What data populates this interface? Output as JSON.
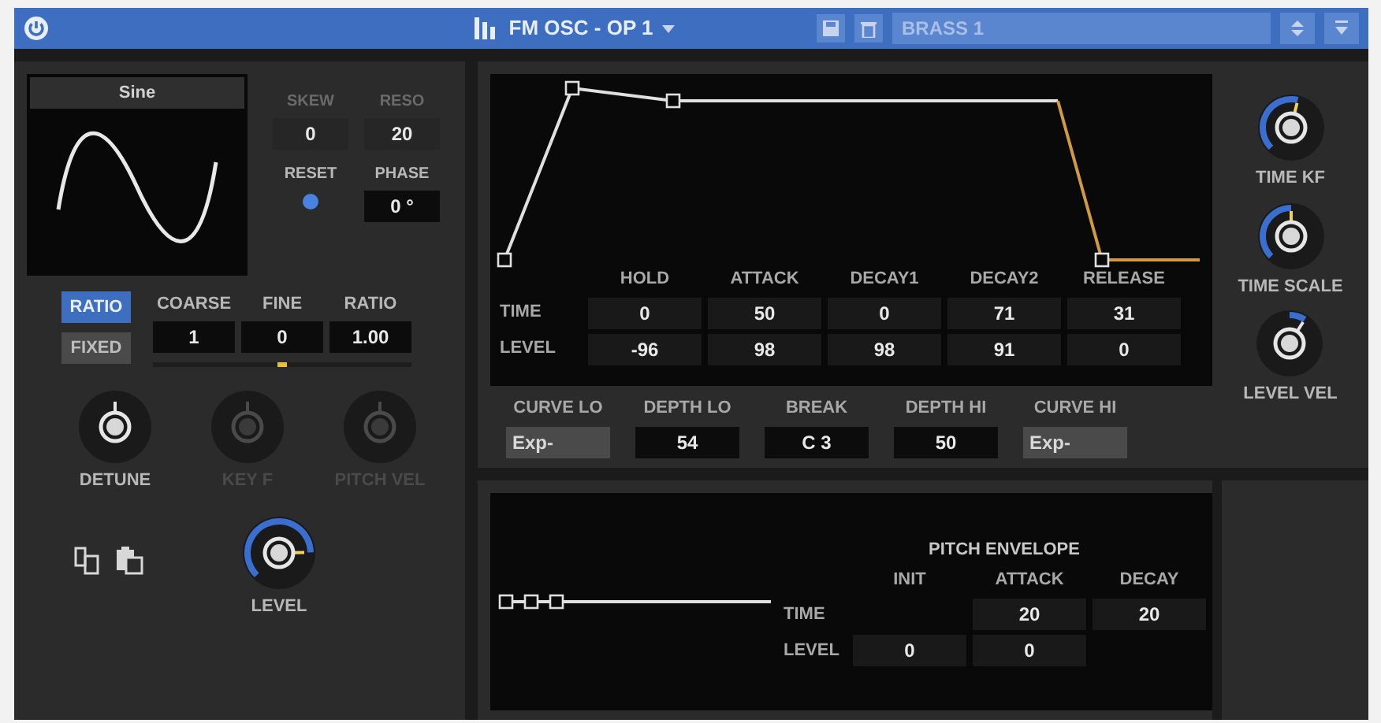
{
  "header": {
    "title": "FM OSC - OP 1",
    "preset": "BRASS 1"
  },
  "oscillator": {
    "waveform": "Sine",
    "disabled_params": [
      {
        "label": "SKEW",
        "value": "0"
      },
      {
        "label": "RESO",
        "value": "20"
      }
    ],
    "reset": {
      "label": "RESET",
      "on": true
    },
    "phase": {
      "label": "PHASE",
      "value": "0 °"
    },
    "modes": [
      {
        "label": "RATIO",
        "selected": true
      },
      {
        "label": "FIXED",
        "selected": false
      }
    ],
    "tuning": [
      {
        "label": "COARSE",
        "value": "1"
      },
      {
        "label": "FINE",
        "value": "0"
      },
      {
        "label": "RATIO",
        "value": "1.00"
      }
    ],
    "fine_slider": {
      "level": 0.5
    },
    "knobs": [
      {
        "label": "DETUNE",
        "disabled": false
      },
      {
        "label": "KEY F",
        "disabled": true
      },
      {
        "label": "PITCH VEL",
        "disabled": true
      }
    ],
    "level_knob": {
      "label": "LEVEL",
      "disabled": false
    }
  },
  "envelope": {
    "columns": [
      "HOLD",
      "ATTACK",
      "DECAY1",
      "DECAY2",
      "RELEASE"
    ],
    "rows": [
      {
        "label": "TIME",
        "values": [
          "0",
          "50",
          "0",
          "71",
          "31"
        ]
      },
      {
        "label": "LEVEL",
        "values": [
          "-96",
          "98",
          "98",
          "91",
          "0"
        ]
      }
    ]
  },
  "curve_controls": [
    {
      "label": "CURVE LO",
      "value": "Exp-",
      "kind": "menu"
    },
    {
      "label": "DEPTH LO",
      "value": "54",
      "kind": "number"
    },
    {
      "label": "BREAK",
      "value": "C 3",
      "kind": "number"
    },
    {
      "label": "DEPTH HI",
      "value": "50",
      "kind": "number"
    },
    {
      "label": "CURVE HI",
      "value": "Exp-",
      "kind": "menu"
    }
  ],
  "side_knobs": [
    {
      "label": "TIME KF",
      "disabled": false
    },
    {
      "label": "TIME SCALE",
      "disabled": false
    },
    {
      "label": "LEVEL VEL",
      "disabled": false
    }
  ],
  "pitch_envelope": {
    "title": "PITCH ENVELOPE",
    "columns": [
      "INIT",
      "ATTACK",
      "DECAY"
    ],
    "rows": [
      {
        "label": "TIME",
        "cells": [
          {
            "kind": "blank"
          },
          {
            "kind": "value",
            "value": "20"
          },
          {
            "kind": "value",
            "value": "20"
          }
        ]
      },
      {
        "label": "LEVEL",
        "cells": [
          {
            "kind": "value",
            "value": "0"
          },
          {
            "kind": "value",
            "value": "0"
          },
          {
            "kind": "blank"
          }
        ]
      }
    ]
  }
}
